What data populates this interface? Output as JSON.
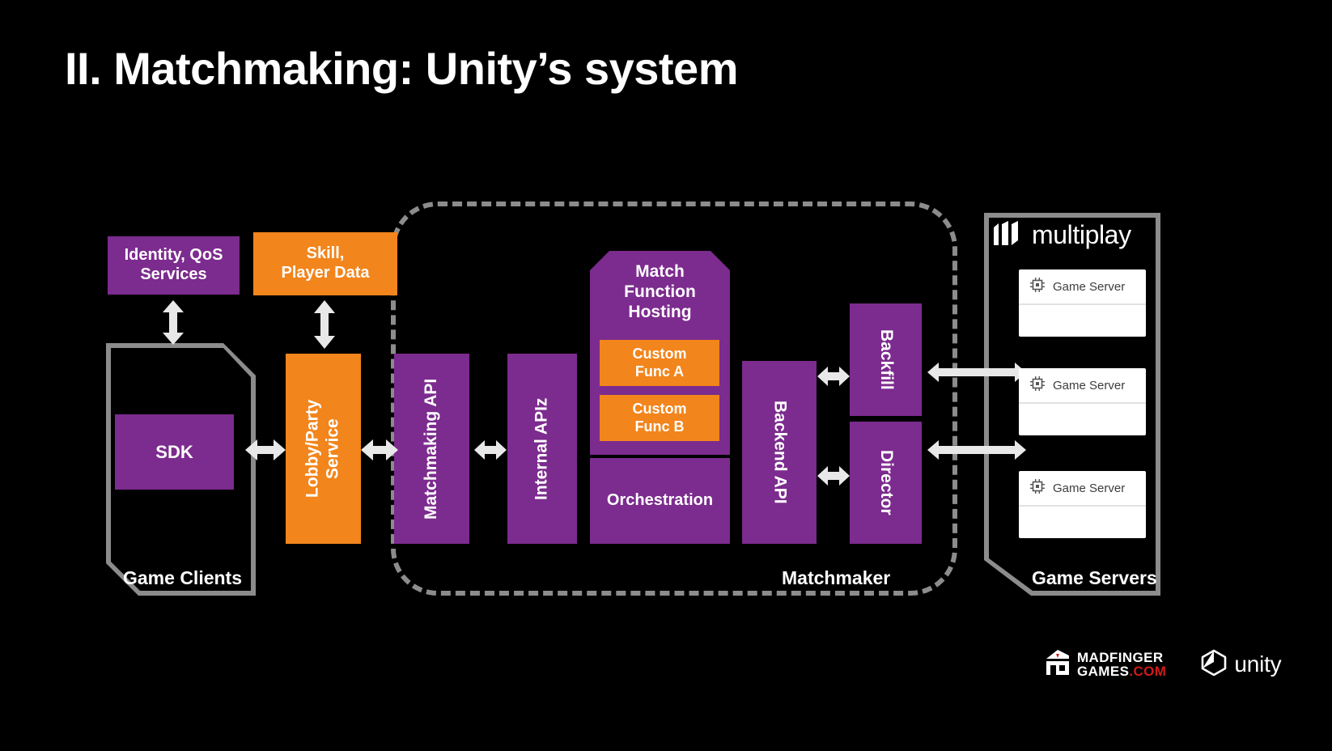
{
  "slide": {
    "title": "II. Matchmaking: Unity’s system",
    "background_color": "#000000",
    "accent_purple": "#7c2b8e",
    "accent_orange": "#f2851c",
    "frame_grey": "#8c8c8c"
  },
  "groups": {
    "game_clients": {
      "label": "Game Clients"
    },
    "matchmaker": {
      "label": "Matchmaker"
    },
    "game_servers": {
      "label": "Game Servers"
    }
  },
  "boxes": {
    "identity_qos": {
      "label": "Identity, QoS\nServices",
      "color": "#7c2b8e"
    },
    "skill_player_data": {
      "label": "Skill,\nPlayer Data",
      "color": "#f2851c"
    },
    "sdk": {
      "label": "SDK",
      "color": "#7c2b8e"
    },
    "lobby_party": {
      "label": "Lobby/Party\nService",
      "color": "#f2851c"
    },
    "matchmaking_api": {
      "label": "Matchmaking API",
      "color": "#7c2b8e"
    },
    "internal_apiz": {
      "label": "Internal APIz",
      "color": "#7c2b8e"
    },
    "match_function_hosting": {
      "label": "Match\nFunction\nHosting",
      "color": "#7c2b8e"
    },
    "custom_func_a": {
      "label": "Custom\nFunc A",
      "color": "#f2851c"
    },
    "custom_func_b": {
      "label": "Custom\nFunc B",
      "color": "#f2851c"
    },
    "orchestration": {
      "label": "Orchestration",
      "color": "#7c2b8e"
    },
    "backend_api": {
      "label": "Backend API",
      "color": "#7c2b8e"
    },
    "backfill": {
      "label": "Backfill",
      "color": "#7c2b8e"
    },
    "director": {
      "label": "Director",
      "color": "#7c2b8e"
    }
  },
  "multiplay": {
    "wordmark": "multiplay",
    "logo_icon": "multiplay-logo-icon",
    "servers": [
      {
        "label": "Game Server",
        "icon": "chip-icon"
      },
      {
        "label": "Game Server",
        "icon": "chip-icon"
      },
      {
        "label": "Game Server",
        "icon": "chip-icon"
      }
    ]
  },
  "footer": {
    "madfinger": {
      "line1": "MADFINGER",
      "line2_main": "GAMES",
      "line2_com": ".COM",
      "icon": "madfinger-logo-icon",
      "com_color": "#d01b1b"
    },
    "unity": {
      "wordmark": "unity",
      "icon": "unity-cube-icon"
    }
  },
  "connectors": [
    {
      "name": "identity-to-game-clients",
      "direction": "bidirectional",
      "orientation": "vertical"
    },
    {
      "name": "skill-to-lobby-party",
      "direction": "bidirectional",
      "orientation": "vertical"
    },
    {
      "name": "sdk-to-lobby-party",
      "direction": "bidirectional",
      "orientation": "horizontal"
    },
    {
      "name": "lobby-party-to-matchmaking-api",
      "direction": "bidirectional",
      "orientation": "horizontal"
    },
    {
      "name": "matchmaking-api-to-internal-apiz",
      "direction": "bidirectional",
      "orientation": "horizontal"
    },
    {
      "name": "backend-api-to-backfill",
      "direction": "bidirectional",
      "orientation": "horizontal"
    },
    {
      "name": "backend-api-to-director",
      "direction": "bidirectional",
      "orientation": "horizontal"
    },
    {
      "name": "backfill-to-game-servers",
      "direction": "bidirectional",
      "orientation": "horizontal"
    },
    {
      "name": "director-to-game-servers",
      "direction": "bidirectional",
      "orientation": "horizontal"
    }
  ]
}
